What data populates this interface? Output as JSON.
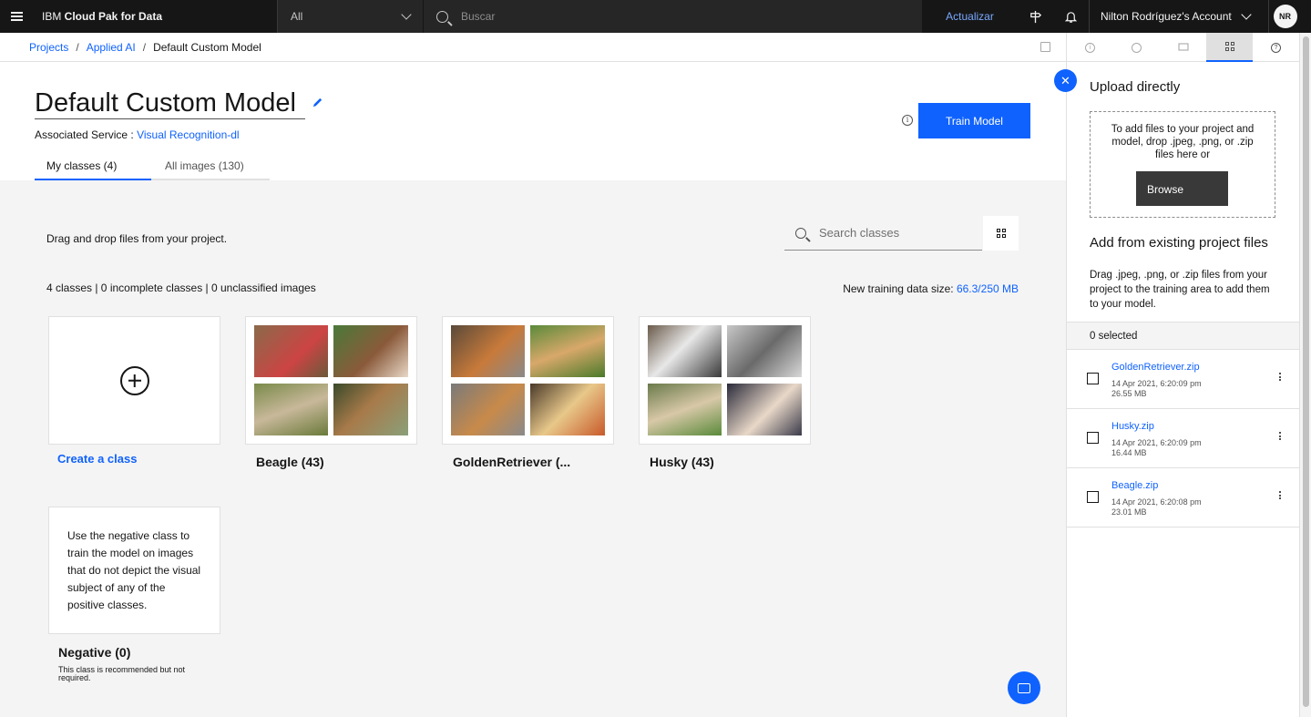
{
  "topbar": {
    "brand_prefix": "IBM ",
    "brand_name": "Cloud Pak for Data",
    "scope_value": "All",
    "search_placeholder": "Buscar",
    "upgrade_label": "Actualizar",
    "account_name": "Nilton Rodríguez's Account",
    "avatar_initials": "NR"
  },
  "breadcrumb": {
    "items": [
      "Projects",
      "Applied AI",
      "Default Custom Model"
    ]
  },
  "header": {
    "title": "Default Custom Model",
    "associated_service_label": "Associated Service : ",
    "associated_service_value": "Visual Recognition-dl",
    "train_button": "Train Model",
    "tabs": [
      {
        "label": "My classes (4)",
        "active": true
      },
      {
        "label": "All images (130)",
        "active": false
      }
    ]
  },
  "main": {
    "drag_text": "Drag and drop files from your project.",
    "search_placeholder": "Search classes",
    "counts_text": "4 classes | 0 incomplete classes | 0 unclassified images",
    "training_size_label": "New training data size: ",
    "training_size_value": "66.3/250 MB",
    "create_class_label": "Create a class",
    "classes": [
      {
        "label": "Beagle (43)",
        "thumbs": [
          "#8a6a4a",
          "#4a7a3a",
          "#7a8a4a",
          "#3a4a2a"
        ]
      },
      {
        "label": "GoldenRetriever (...",
        "thumbs": [
          "#5a4a3a",
          "#5a8a3a",
          "#7a7a7a",
          "#4a3a2a"
        ]
      },
      {
        "label": "Husky (43)",
        "thumbs": [
          "#6a5a4a",
          "#c8c8c8",
          "#6a7a4a",
          "#2a2a3a"
        ]
      }
    ],
    "negative_card_text": "Use the negative class to train the model on images that do not depict the visual subject of any of the positive classes.",
    "negative_label": "Negative (0)",
    "negative_note": "This class is recommended but not required."
  },
  "panel": {
    "upload_heading": "Upload directly",
    "dropzone_text": "To add files to your project and model, drop .jpeg, .png, or .zip files here or",
    "browse_label": "Browse",
    "existing_heading": "Add from existing project files",
    "existing_desc": "Drag .jpeg, .png, or .zip files from your project to the training area to add them to your model.",
    "selected_text": "0 selected",
    "files": [
      {
        "name": "GoldenRetriever.zip",
        "date": "14 Apr 2021, 6:20:09 pm",
        "size": "26.55 MB"
      },
      {
        "name": "Husky.zip",
        "date": "14 Apr 2021, 6:20:09 pm",
        "size": "16.44 MB"
      },
      {
        "name": "Beagle.zip",
        "date": "14 Apr 2021, 6:20:08 pm",
        "size": "23.01 MB"
      }
    ]
  },
  "colors": {
    "accent": "#0f62fe",
    "topbar_bg": "#161616",
    "page_bg": "#f4f4f4"
  }
}
